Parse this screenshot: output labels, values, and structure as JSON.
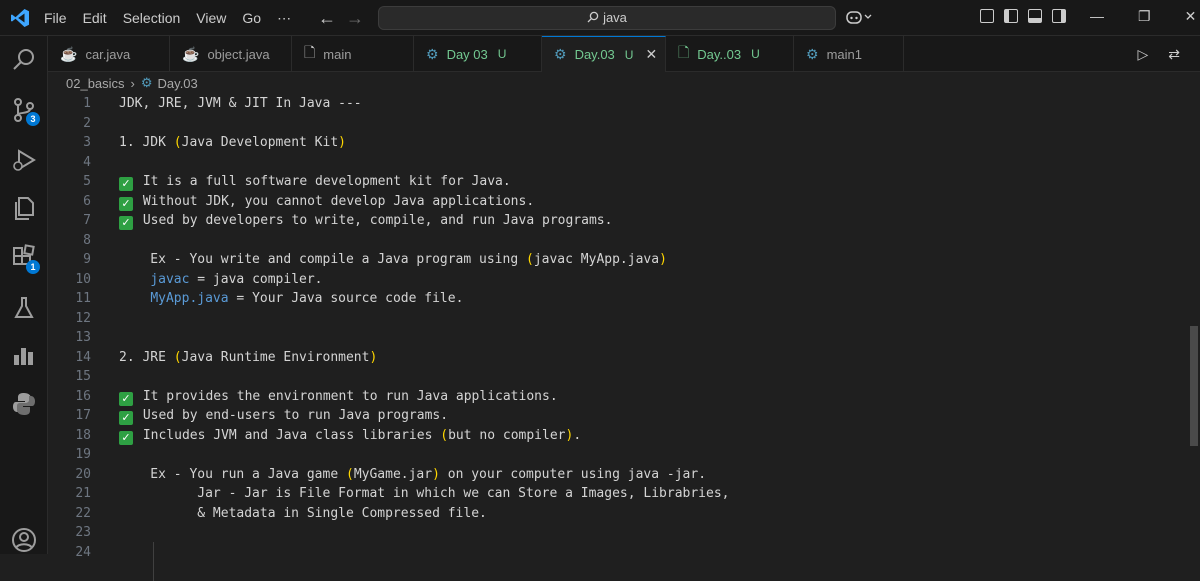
{
  "menu": [
    "File",
    "Edit",
    "Selection",
    "View",
    "Go",
    "⋯"
  ],
  "search": {
    "text": "java"
  },
  "tabs": [
    {
      "label": "car.java",
      "icon": "java-icon",
      "status": "",
      "active": false
    },
    {
      "label": "object.java",
      "icon": "java-icon",
      "status": "",
      "active": false
    },
    {
      "label": "main",
      "icon": "file-icon",
      "status": "",
      "active": false
    },
    {
      "label": "Day 03",
      "icon": "gear-icon",
      "status": "U",
      "active": false
    },
    {
      "label": "Day.03",
      "icon": "gear-icon",
      "status": "U",
      "active": true
    },
    {
      "label": "Day..03",
      "icon": "file-icon",
      "status": "U",
      "active": false
    },
    {
      "label": "main1",
      "icon": "gear-icon",
      "status": "",
      "active": false
    }
  ],
  "breadcrumb": {
    "folder": "02_basics",
    "file": "Day.03"
  },
  "activity": {
    "scm_badge": "3",
    "extensions_badge": "1"
  },
  "lines": [
    {
      "n": "1",
      "text": "JDK, JRE, JVM & JIT In Java ---"
    },
    {
      "n": "2",
      "text": ""
    },
    {
      "n": "3",
      "pre": "1. JDK ",
      "paren": "(",
      "mid": "Java Development Kit",
      "paren2": ")"
    },
    {
      "n": "4",
      "text": ""
    },
    {
      "n": "5",
      "check": true,
      "text": " It is a full software development kit for Java."
    },
    {
      "n": "6",
      "check": true,
      "text": " Without JDK, you cannot develop Java applications."
    },
    {
      "n": "7",
      "check": true,
      "text": " Used by developers to write, compile, and run Java programs."
    },
    {
      "n": "8",
      "text": ""
    },
    {
      "n": "9",
      "pre": "    Ex - You write and compile a Java program using ",
      "paren": "(",
      "mid": "javac MyApp.java",
      "paren2": ")"
    },
    {
      "n": "10",
      "kwpre": "    ",
      "kw": "javac",
      "text": " = java compiler."
    },
    {
      "n": "11",
      "kwpre": "    ",
      "kw": "MyApp.java",
      "text": " = Your Java source code file."
    },
    {
      "n": "12",
      "text": ""
    },
    {
      "n": "13",
      "text": ""
    },
    {
      "n": "14",
      "pre": "2. JRE ",
      "paren": "(",
      "mid": "Java Runtime Environment",
      "paren2": ")"
    },
    {
      "n": "15",
      "text": ""
    },
    {
      "n": "16",
      "check": true,
      "text": " It provides the environment to run Java applications."
    },
    {
      "n": "17",
      "check": true,
      "text": " Used by end-users to run Java programs."
    },
    {
      "n": "18",
      "check": true,
      "pre": " Includes JVM and Java class libraries ",
      "paren": "(",
      "mid": "but no compiler",
      "paren2": ")",
      "post": "."
    },
    {
      "n": "19",
      "text": ""
    },
    {
      "n": "20",
      "pre": "    Ex - You run a Java game ",
      "paren": "(",
      "mid": "MyGame.jar",
      "paren2": ")",
      "post": " on your computer using java -jar."
    },
    {
      "n": "21",
      "text": "          Jar - Jar is File Format in which we can Store a Images, Librabries,"
    },
    {
      "n": "22",
      "text": "          & Metadata in Single Compressed file."
    },
    {
      "n": "23",
      "text": ""
    },
    {
      "n": "24",
      "text": ""
    }
  ]
}
